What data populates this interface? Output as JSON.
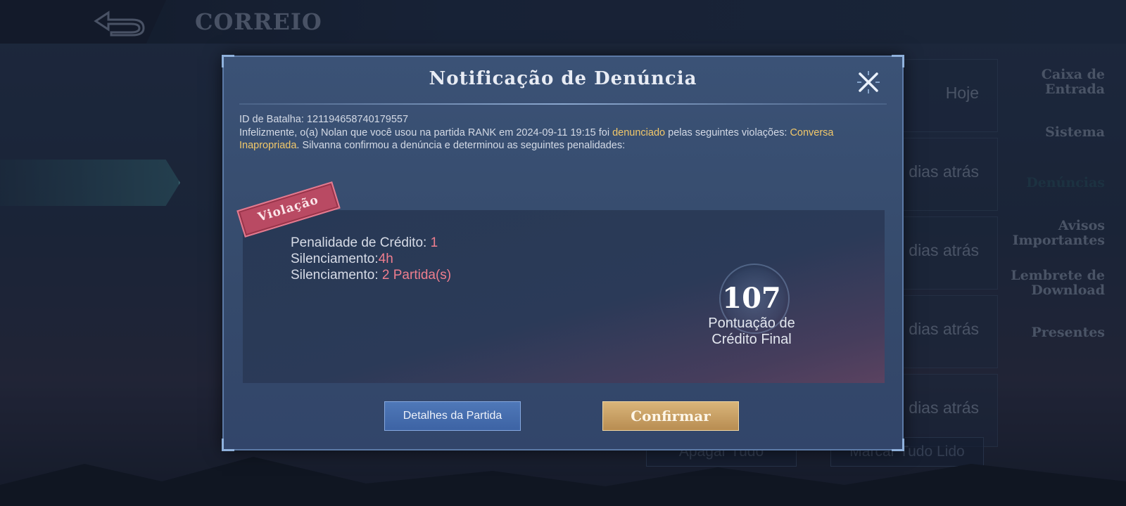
{
  "app": {
    "page_title": "CORREIO",
    "sidebar": {
      "items": [
        {
          "label_line1": "Caixa de",
          "label_line2": "Entrada"
        },
        {
          "label_line1": "Sistema",
          "label_line2": ""
        },
        {
          "label_line1": "Denúncias",
          "label_line2": ""
        },
        {
          "label_line1": "Avisos",
          "label_line2": "Importantes"
        },
        {
          "label_line1": "Lembrete de",
          "label_line2": "Download"
        },
        {
          "label_line1": "Presentes",
          "label_line2": ""
        }
      ],
      "active_index": 2
    },
    "list": {
      "times": [
        "Hoje",
        "dias atrás",
        "dias atrás",
        "dias atrás",
        "dias atrás"
      ]
    },
    "bottom_buttons": {
      "delete_all": "Apagar Tudo",
      "mark_all_read": "Marcar Tudo Lido"
    }
  },
  "dialog": {
    "title": "Notificação de Denúncia",
    "battle_id_label": "ID de Batalha:",
    "battle_id": "121194658740179557",
    "message": {
      "part1": "Infelizmente, o(a) Nolan que você usou na partida RANK em 2024-09-11 19:15 foi ",
      "highlight1": "denunciado",
      "part2": " pelas seguintes violações: ",
      "highlight2": "Conversa Inapropriada",
      "part3": ". Silvanna confirmou a denúncia e determinou as seguintes penalidades:"
    },
    "stamp": "Violação",
    "penalties": [
      {
        "label": "Penalidade de Crédito: ",
        "value": "1"
      },
      {
        "label": "Silenciamento:",
        "value": "4h"
      },
      {
        "label": "Silenciamento: ",
        "value": "2 Partida(s)"
      }
    ],
    "score": {
      "value": "107",
      "label_line1": "Pontuação de",
      "label_line2": "Crédito Final"
    },
    "buttons": {
      "details": "Detalhes da Partida",
      "confirm": "Confirmar"
    },
    "colors": {
      "highlight": "#f2c86a",
      "penalty_value": "#ef7e8e",
      "confirm_gold": "#d9b57a",
      "details_blue": "#4f78b8"
    }
  }
}
